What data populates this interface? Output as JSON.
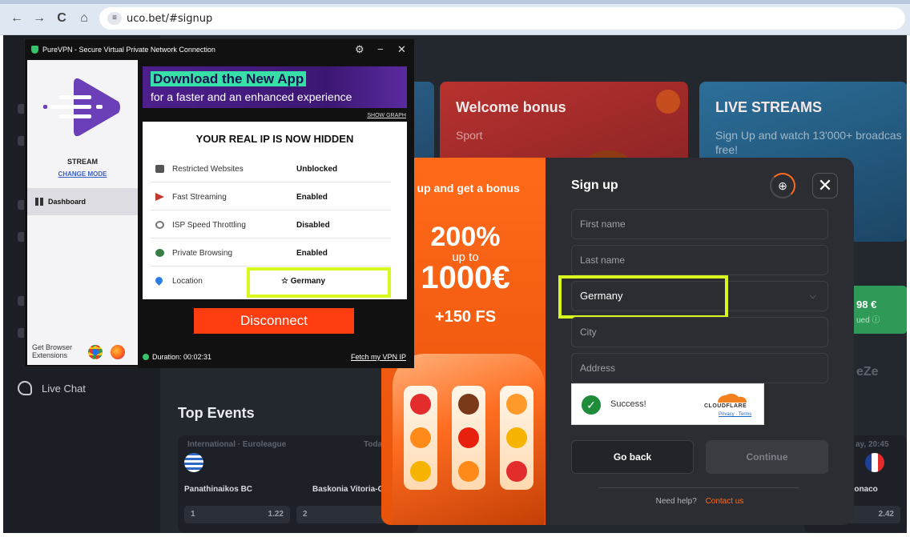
{
  "browser": {
    "url": "uco.bet/#signup",
    "back_icon": "←",
    "forward_icon": "→",
    "reload_icon": "C",
    "home_icon": "⌂",
    "site_info_icon": "≡"
  },
  "site": {
    "live_chat": "Live Chat",
    "welcome_card": {
      "title": "Welcome bonus",
      "subtitle": "Sport"
    },
    "live_card": {
      "title": "LIVE STREAMS",
      "text": "Sign Up and watch 13'000+ broadcas free!"
    },
    "strip": {
      "amount": "98 €",
      "note": "ued ⓘ"
    },
    "ezee": "eZe",
    "top_events": "Top Events",
    "event": {
      "league": "International · Euroleague",
      "date": "Today,",
      "date_right": "ay, 20:45",
      "team_home": "Panathinaikos BC",
      "team_away": "Baskonia Vitoria-G",
      "team_right": "Monaco",
      "odd1_label": "1",
      "odd1_value": "1.22",
      "odd2_label": "2",
      "odd_right": "2.42"
    }
  },
  "promo": {
    "headline": "n up and get a bonus",
    "percent": "200%",
    "up_to": "up to",
    "amount": "1000€",
    "free_spins": "+150 FS"
  },
  "signup": {
    "title": "Sign up",
    "close_symbol": "✕",
    "gift_symbol": "⊕",
    "first_name_placeholder": "First name",
    "last_name_placeholder": "Last name",
    "country_value": "Germany",
    "city_placeholder": "City",
    "address_placeholder": "Address",
    "captcha_status": "Success!",
    "captcha_check": "✓",
    "cloudflare": "CLOUDFLARE",
    "cloudflare_links": "Privacy · Terms",
    "go_back": "Go back",
    "continue": "Continue",
    "need_help": "Need help?",
    "contact_us": "Contact us",
    "accent_color": "#ff6a1a",
    "highlight_color": "#d9f81d"
  },
  "vpn": {
    "window_title": "PureVPN - Secure Virtual Private Network Connection",
    "settings_icon": "⚙",
    "minimize_icon": "−",
    "close_icon": "✕",
    "mode": "STREAM",
    "change_mode": "CHANGE MODE",
    "dashboard": "Dashboard",
    "get_extensions": "Get Browser Extensions",
    "banner_line1": "Download the New App",
    "banner_line2": "for a faster and an enhanced experience",
    "show_graph": "SHOW GRAPH",
    "ip_header": "YOUR REAL IP IS NOW HIDDEN",
    "rows": [
      {
        "label": "Restricted Websites",
        "value": "Unblocked"
      },
      {
        "label": "Fast Streaming",
        "value": "Enabled"
      },
      {
        "label": "ISP Speed Throttling",
        "value": "Disabled"
      },
      {
        "label": "Private Browsing",
        "value": "Enabled"
      },
      {
        "label": "Location",
        "value": "☆ Germany"
      }
    ],
    "disconnect": "Disconnect",
    "duration": "Duration: 00:02:31",
    "fetch_ip": "Fetch my VPN IP"
  }
}
